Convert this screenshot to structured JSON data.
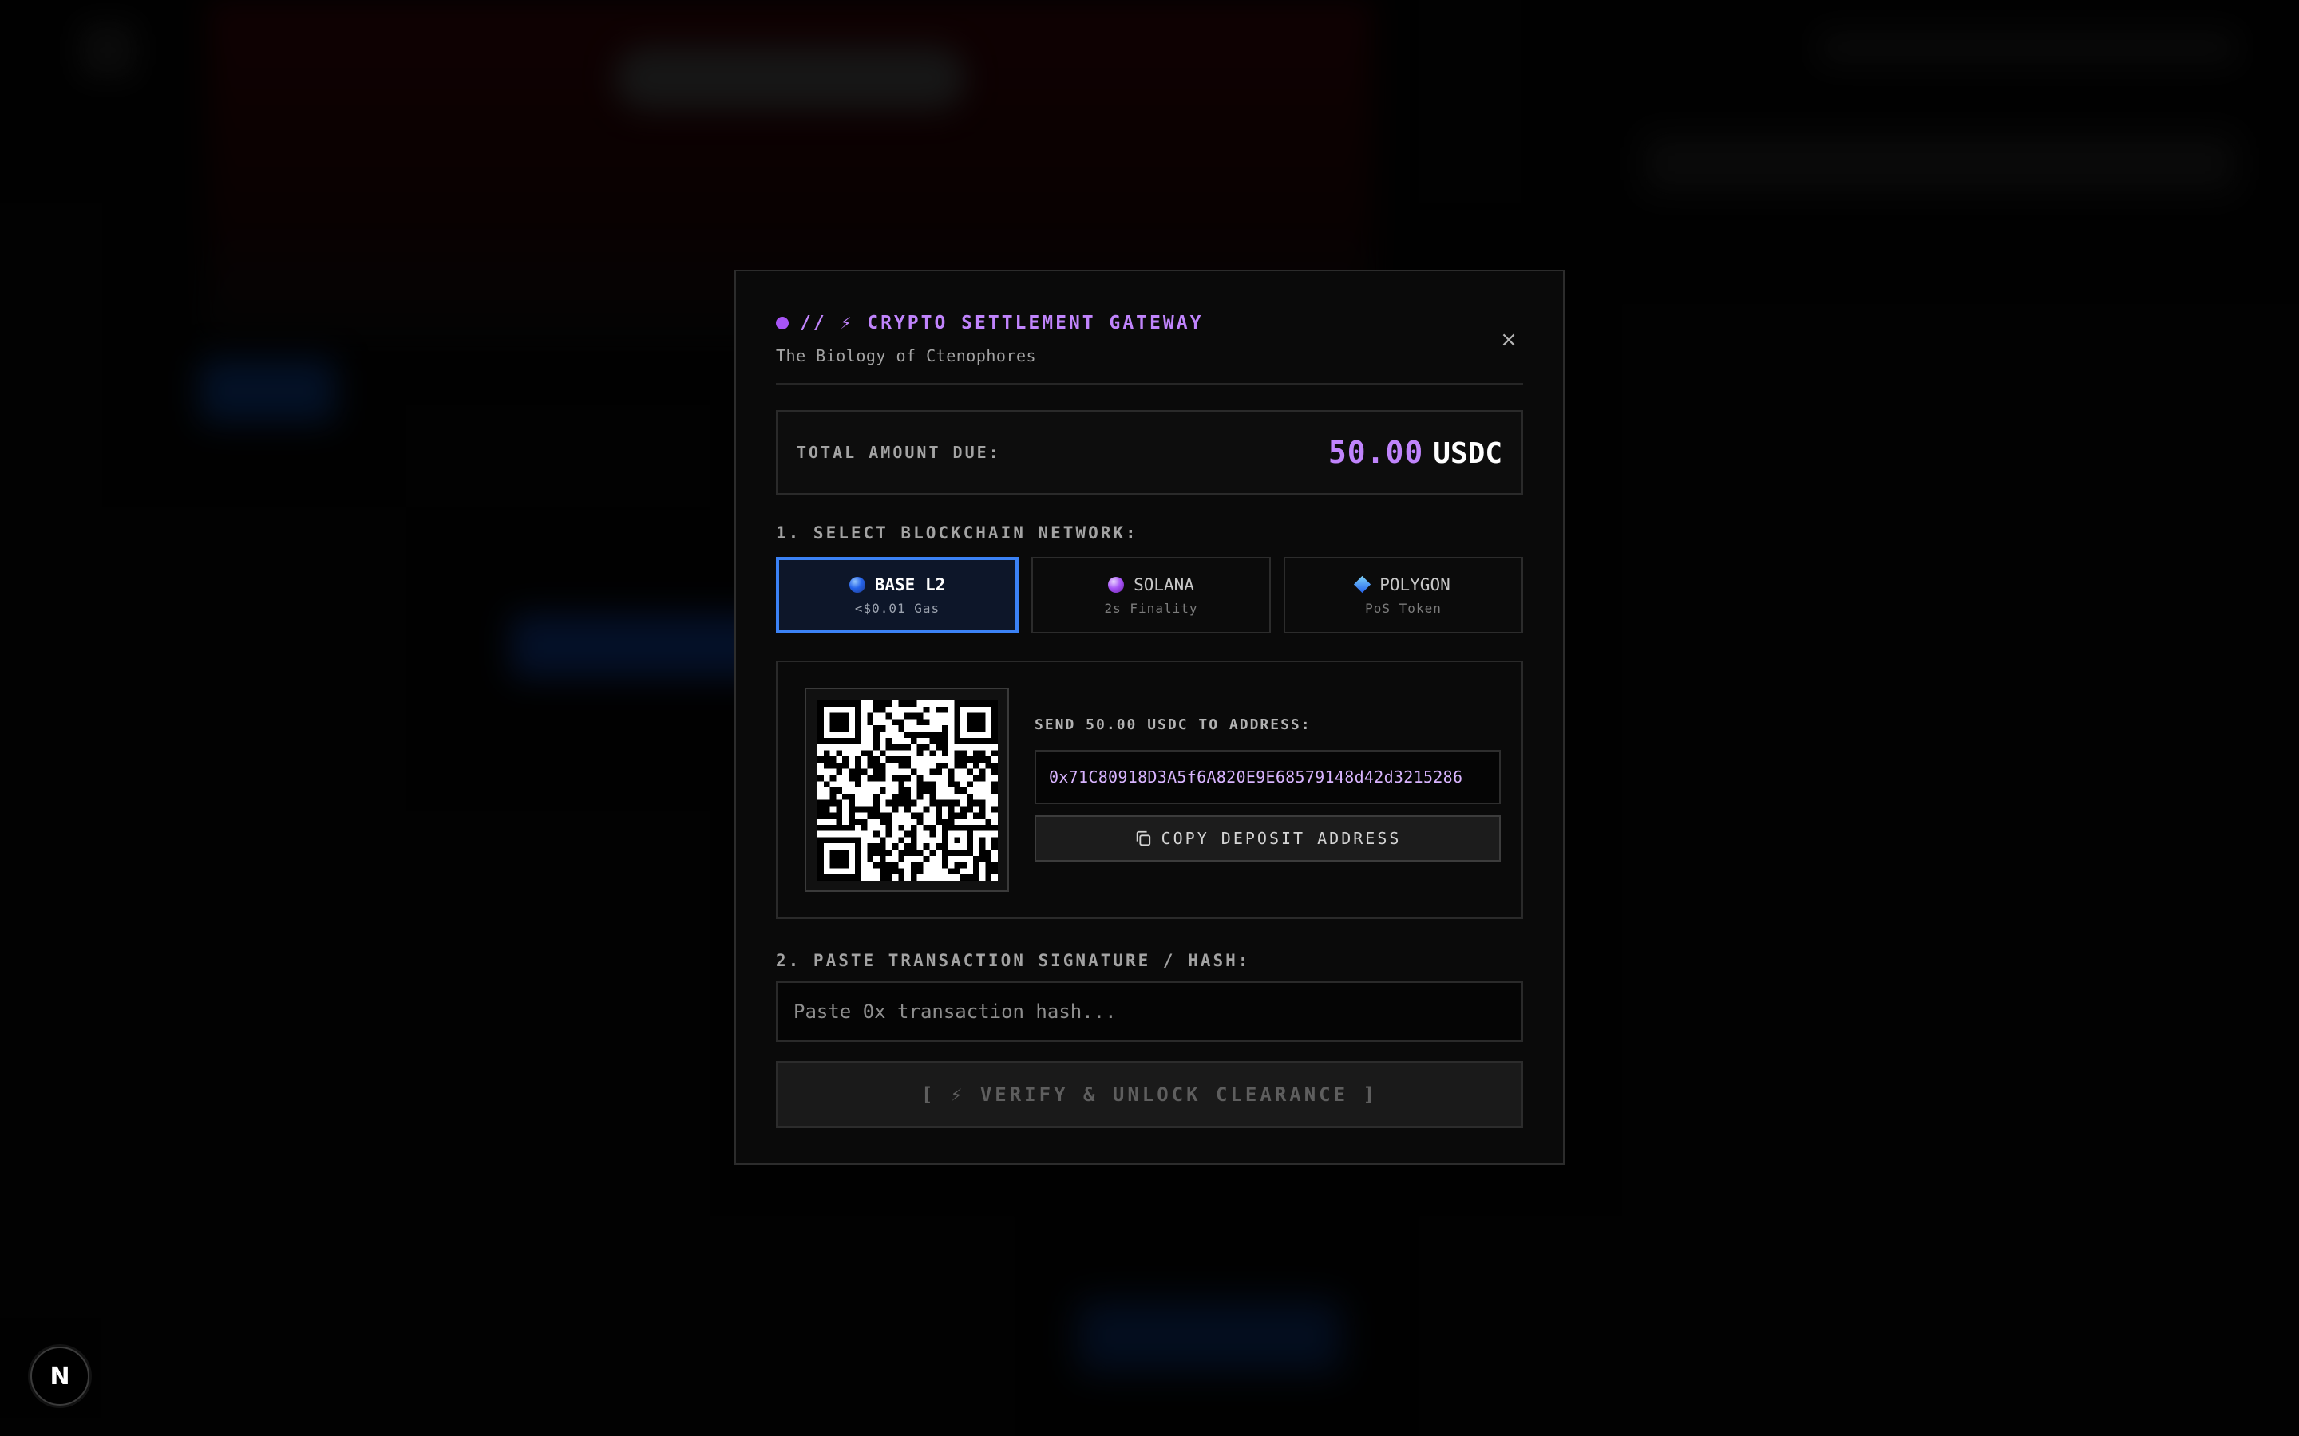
{
  "modal": {
    "title": "// ⚡ CRYPTO SETTLEMENT GATEWAY",
    "subtitle": "The Biology of Ctenophores",
    "close_label": "×",
    "total": {
      "label": "TOTAL AMOUNT DUE:",
      "amount": "50.00",
      "currency": "USDC"
    },
    "network_section_label": "1. SELECT BLOCKCHAIN NETWORK:",
    "networks": [
      {
        "name": "BASE L2",
        "detail": "<$0.01 Gas",
        "icon": "blue-orb-icon",
        "selected": true
      },
      {
        "name": "SOLANA",
        "detail": "2s Finality",
        "icon": "purple-orb-icon",
        "selected": false
      },
      {
        "name": "POLYGON",
        "detail": "PoS Token",
        "icon": "blue-diamond-icon",
        "selected": false
      }
    ],
    "deposit": {
      "send_label": "SEND 50.00 USDC TO ADDRESS:",
      "address": "0x71C80918D3A5f6A820E9E68579148d42d3215286",
      "copy_label": "COPY DEPOSIT ADDRESS",
      "qr_icon": "qr-code-icon",
      "copy_icon": "copy-icon"
    },
    "hash_section_label": "2. PASTE TRANSACTION SIGNATURE / HASH:",
    "hash_input": {
      "value": "",
      "placeholder": "Paste 0x transaction hash..."
    },
    "verify_label": "[ ⚡ VERIFY & UNLOCK CLEARANCE ]"
  },
  "dev_badge": {
    "letter": "N",
    "icon": "nextjs-logo-icon"
  },
  "colors": {
    "accent_purple": "#c084fc",
    "selected_blue": "#3b82f6",
    "modal_bg": "#0a0a0a",
    "page_bg": "#050505"
  }
}
